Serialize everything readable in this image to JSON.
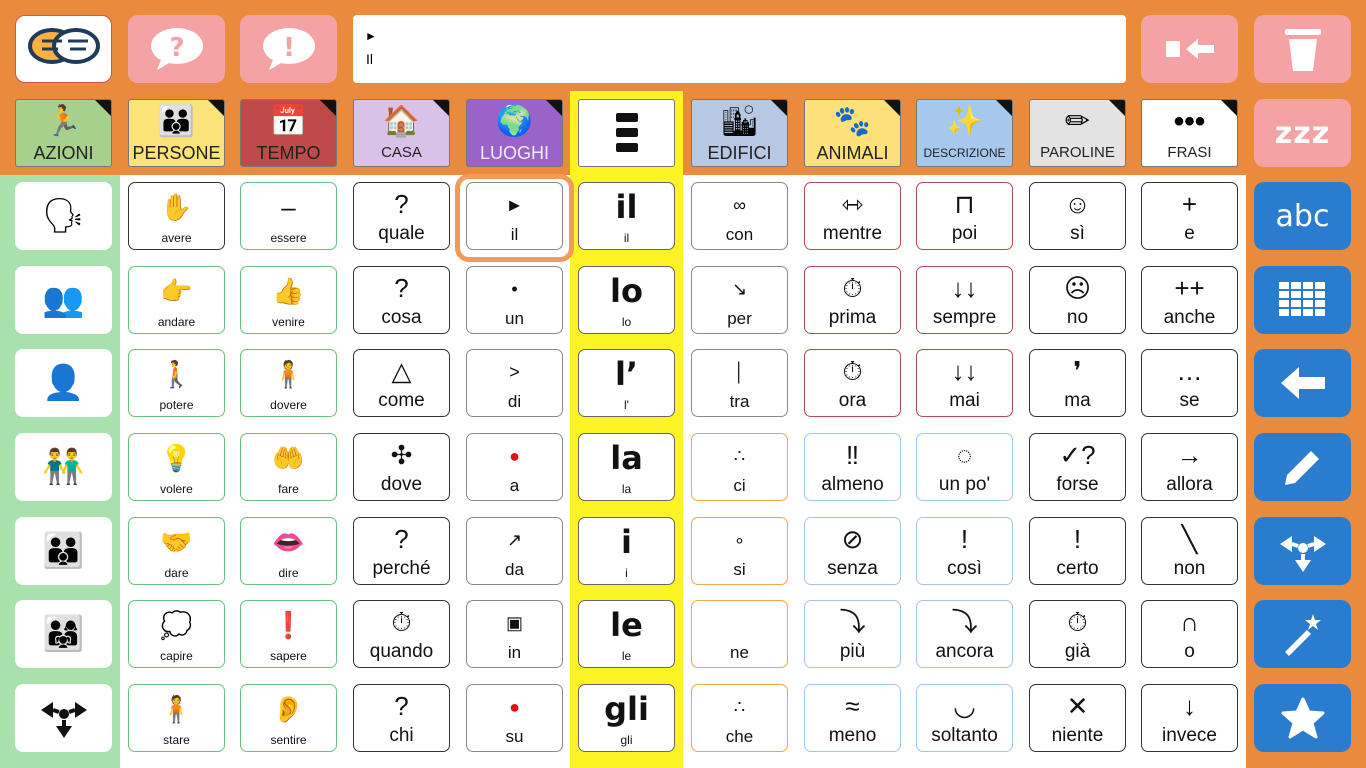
{
  "message_bar": {
    "arrow": "►",
    "text": "Il"
  },
  "top_buttons": {
    "chat_icon": "chat-bubbles-icon",
    "question_icon": "question-icon",
    "exclaim_icon": "exclamation-icon",
    "backspace_icon": "backspace-icon",
    "trash_icon": "trash-icon"
  },
  "categories": [
    {
      "label": "AZIONI",
      "color": "#a8d08d"
    },
    {
      "label": "PERSONE",
      "color": "#fbe37a"
    },
    {
      "label": "TEMPO",
      "color": "#c04a4a"
    },
    {
      "label": "CASA",
      "color": "#d8c2e8"
    },
    {
      "label": "LUOGHI",
      "color": "#9a63c9"
    },
    {
      "label": "",
      "color": "#ffffff"
    },
    {
      "label": "EDIFICI",
      "color": "#b7c9e2"
    },
    {
      "label": "ANIMALI",
      "color": "#fce07a"
    },
    {
      "label": "DESCRIZIONE",
      "color": "#a6c8ec"
    },
    {
      "label": "PAROLINE",
      "color": "#e3e3e3"
    },
    {
      "label": "FRASI",
      "color": "#ffffff"
    }
  ],
  "sleep_label": "zzz",
  "grid": {
    "col1": [
      "avere",
      "andare",
      "potere",
      "volere",
      "dare",
      "capire",
      "stare"
    ],
    "col2": [
      "essere",
      "venire",
      "dovere",
      "fare",
      "dire",
      "sapere",
      "sentire"
    ],
    "col3": [
      "quale",
      "cosa",
      "come",
      "dove",
      "perché",
      "quando",
      "chi"
    ],
    "col4": [
      "il",
      "un",
      "di",
      "a",
      "da",
      "in",
      "su"
    ],
    "col5": [
      {
        "big": "il",
        "small": "il"
      },
      {
        "big": "lo",
        "small": "lo"
      },
      {
        "big": "l’",
        "small": "l'"
      },
      {
        "big": "la",
        "small": "la"
      },
      {
        "big": "i",
        "small": "i"
      },
      {
        "big": "le",
        "small": "le"
      },
      {
        "big": "gli",
        "small": "gli"
      }
    ],
    "col6": [
      "con",
      "per",
      "tra",
      "ci",
      "si",
      "ne",
      "che"
    ],
    "col7": [
      "mentre",
      "prima",
      "ora",
      "almeno",
      "senza",
      "più",
      "meno"
    ],
    "col8": [
      "poi",
      "sempre",
      "mai",
      "un po'",
      "così",
      "ancora",
      "soltanto"
    ],
    "col9": [
      "sì",
      "no",
      "ma",
      "forse",
      "certo",
      "già",
      "niente"
    ],
    "col10": [
      "e",
      "anche",
      "se",
      "allora",
      "non",
      "o",
      "invece"
    ]
  },
  "right_panel": {
    "abc_label": "abc"
  },
  "colors": {
    "orange": "#ea8a3c",
    "green_panel": "#a9e1ad",
    "yellow_col": "#fbf323",
    "blue_btn": "#2a7ccf",
    "pink_btn": "#f3a3a3"
  }
}
